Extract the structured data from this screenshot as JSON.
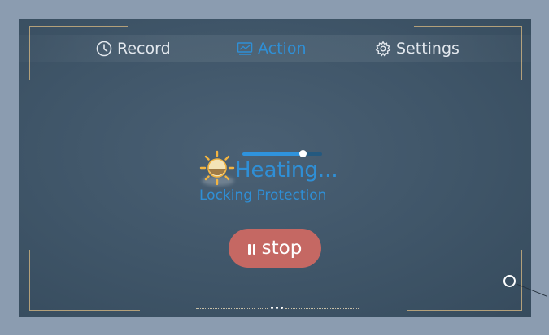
{
  "nav": {
    "tabs": [
      {
        "label": "Record",
        "icon": "clock-icon",
        "active": false
      },
      {
        "label": "Action",
        "icon": "monitor-icon",
        "active": true
      },
      {
        "label": "Settings",
        "icon": "gear-icon",
        "active": false
      }
    ]
  },
  "status": {
    "icon": "sun-icon",
    "title": "Heating...",
    "subtitle": "Locking Protection",
    "progress": 0.75
  },
  "controls": {
    "stop_label": "stop",
    "stop_icon": "pause-icon"
  },
  "pager": {
    "dots": 3
  },
  "colors": {
    "accent": "#2f8fd6",
    "stop_button": "#c56863",
    "frame": "#8b9cb0",
    "screen": "#3f5568",
    "bracket": "#b3a07a"
  }
}
